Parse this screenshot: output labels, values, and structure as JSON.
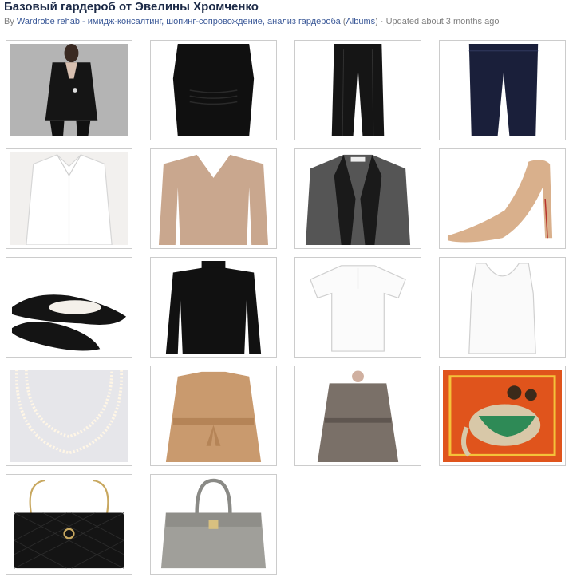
{
  "album": {
    "title": "Базовый гардероб от Эвелины Хромченко",
    "by_prefix": "By ",
    "author": "Wardrobe rehab - имидж-консалтинг, шопинг-сопровождение, анализ гардероба",
    "albums_open": " (",
    "albums_link": "Albums",
    "albums_close": ")",
    "updated": " · Updated about 3 months ago"
  },
  "photos": [
    {
      "id": "black-blazer-outfit",
      "icon": "photo-black-blazer"
    },
    {
      "id": "black-sheath-dress",
      "icon": "photo-black-dress"
    },
    {
      "id": "black-trousers",
      "icon": "photo-black-trousers"
    },
    {
      "id": "dark-jeans",
      "icon": "photo-dark-jeans"
    },
    {
      "id": "white-shirt",
      "icon": "photo-white-shirt"
    },
    {
      "id": "beige-sweater",
      "icon": "photo-beige-sweater"
    },
    {
      "id": "grey-leather-jacket",
      "icon": "photo-grey-jacket"
    },
    {
      "id": "nude-pumps",
      "icon": "photo-nude-pumps"
    },
    {
      "id": "black-ballet-flats",
      "icon": "photo-ballet-flats"
    },
    {
      "id": "black-turtleneck",
      "icon": "photo-black-turtleneck"
    },
    {
      "id": "white-tshirt",
      "icon": "photo-white-tshirt"
    },
    {
      "id": "white-tank-top",
      "icon": "photo-white-tank"
    },
    {
      "id": "pearl-necklace",
      "icon": "photo-pearl-necklace"
    },
    {
      "id": "camel-coat",
      "icon": "photo-camel-coat"
    },
    {
      "id": "grey-trench-coat",
      "icon": "photo-trench-coat"
    },
    {
      "id": "ethnic-scarf",
      "icon": "photo-elephant-scarf"
    },
    {
      "id": "chanel-bag",
      "icon": "photo-quilted-bag"
    },
    {
      "id": "grey-tote-bag",
      "icon": "photo-grey-tote"
    }
  ]
}
